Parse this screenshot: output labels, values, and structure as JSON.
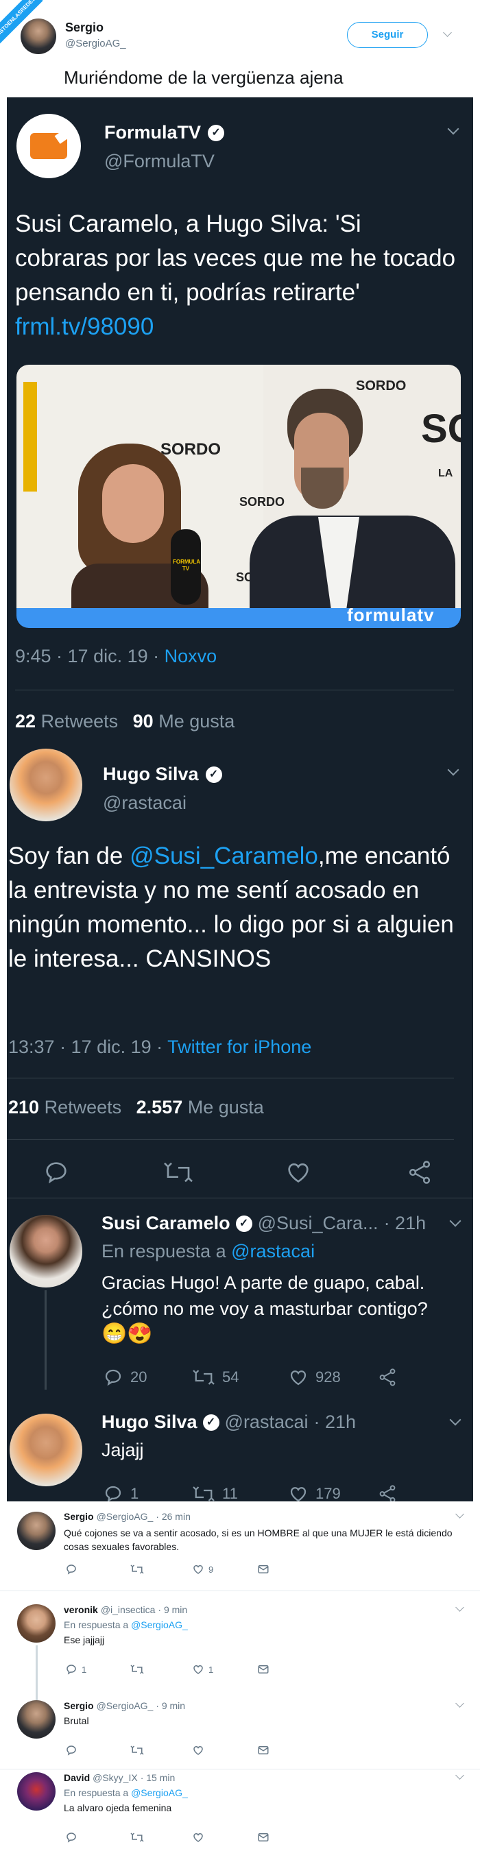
{
  "header": {
    "badge": "VISTOENLASREDES",
    "name": "Sergio",
    "handle": "@SergioAG_",
    "follow_label": "Seguir",
    "tweet_text": "Muriéndome de la vergüenza ajena"
  },
  "quote1": {
    "name": "FormulaTV",
    "handle": "@FormulaTV",
    "text": "Susi Caramelo, a Hugo Silva: 'Si cobraras por las veces que me he tocado pensando en ti, podrías retirarte'",
    "link": "frml.tv/98090",
    "image_watermark": "formulatv",
    "image_signs": [
      "SORDO",
      "SORDO",
      "SORDO",
      "SORDO",
      "SO",
      "LA"
    ],
    "mic_label": "FORMULA TV",
    "time": "9:45 · 17 dic. 19 · ",
    "source": "Noxvo",
    "retweets_count": "22",
    "retweets_label": "Retweets",
    "likes_count": "90",
    "likes_label": "Me gusta"
  },
  "quote2": {
    "name": "Hugo Silva",
    "handle": "@rastacai",
    "text_pre": "Soy fan de ",
    "mention": "@Susi_Caramelo",
    "text_post": ",me encantó la entrevista y no me sentí acosado en ningún momento... lo digo por si a alguien le interesa... CANSINOS",
    "time": "13:37 · 17 dic. 19 · ",
    "source": "Twitter for iPhone",
    "retweets_count": "210",
    "retweets_label": "Retweets",
    "likes_count": "2.557",
    "likes_label": "Me gusta"
  },
  "reply1": {
    "name": "Susi Caramelo",
    "handle": "@Susi_Cara...",
    "time": "· 21h",
    "reply_to_label": "En respuesta a ",
    "reply_to": "@rastacai",
    "text": "Gracias Hugo! A parte de guapo, cabal. ¿cómo no me voy a masturbar contigo?",
    "emojis": "😁😍",
    "replies": "20",
    "retweets": "54",
    "likes": "928"
  },
  "reply2": {
    "name": "Hugo Silva",
    "handle": "@rastacai",
    "time": "· 21h",
    "text": "Jajajj",
    "replies": "1",
    "retweets": "11",
    "likes": "179"
  },
  "thread": [
    {
      "name": "Sergio",
      "handle": "@SergioAG_",
      "time": "· 26 min",
      "reply_to_label": "",
      "reply_to": "",
      "text": "Qué cojones se va a sentir acosado, si es un HOMBRE al que una MUJER le está diciendo cosas sexuales favorables.",
      "replies": "",
      "retweets": "",
      "likes": "9"
    },
    {
      "name": "veronik",
      "handle": "@i_insectica",
      "time": "· 9 min",
      "reply_to_label": "En respuesta a ",
      "reply_to": "@SergioAG_",
      "text": "Ese jajjajj",
      "replies": "1",
      "retweets": "",
      "likes": "1"
    },
    {
      "name": "Sergio",
      "handle": "@SergioAG_",
      "time": "· 9 min",
      "reply_to_label": "",
      "reply_to": "",
      "text": "Brutal",
      "replies": "",
      "retweets": "",
      "likes": ""
    },
    {
      "name": "David",
      "handle": "@Skyy_IX",
      "time": "· 15 min",
      "reply_to_label": "En respuesta a ",
      "reply_to": "@SergioAG_",
      "text": "La alvaro ojeda femenina",
      "replies": "",
      "retweets": "",
      "likes": ""
    }
  ],
  "colors": {
    "dark_bg": "#15202b",
    "accent": "#1da1f2",
    "muted": "#8899a6"
  }
}
